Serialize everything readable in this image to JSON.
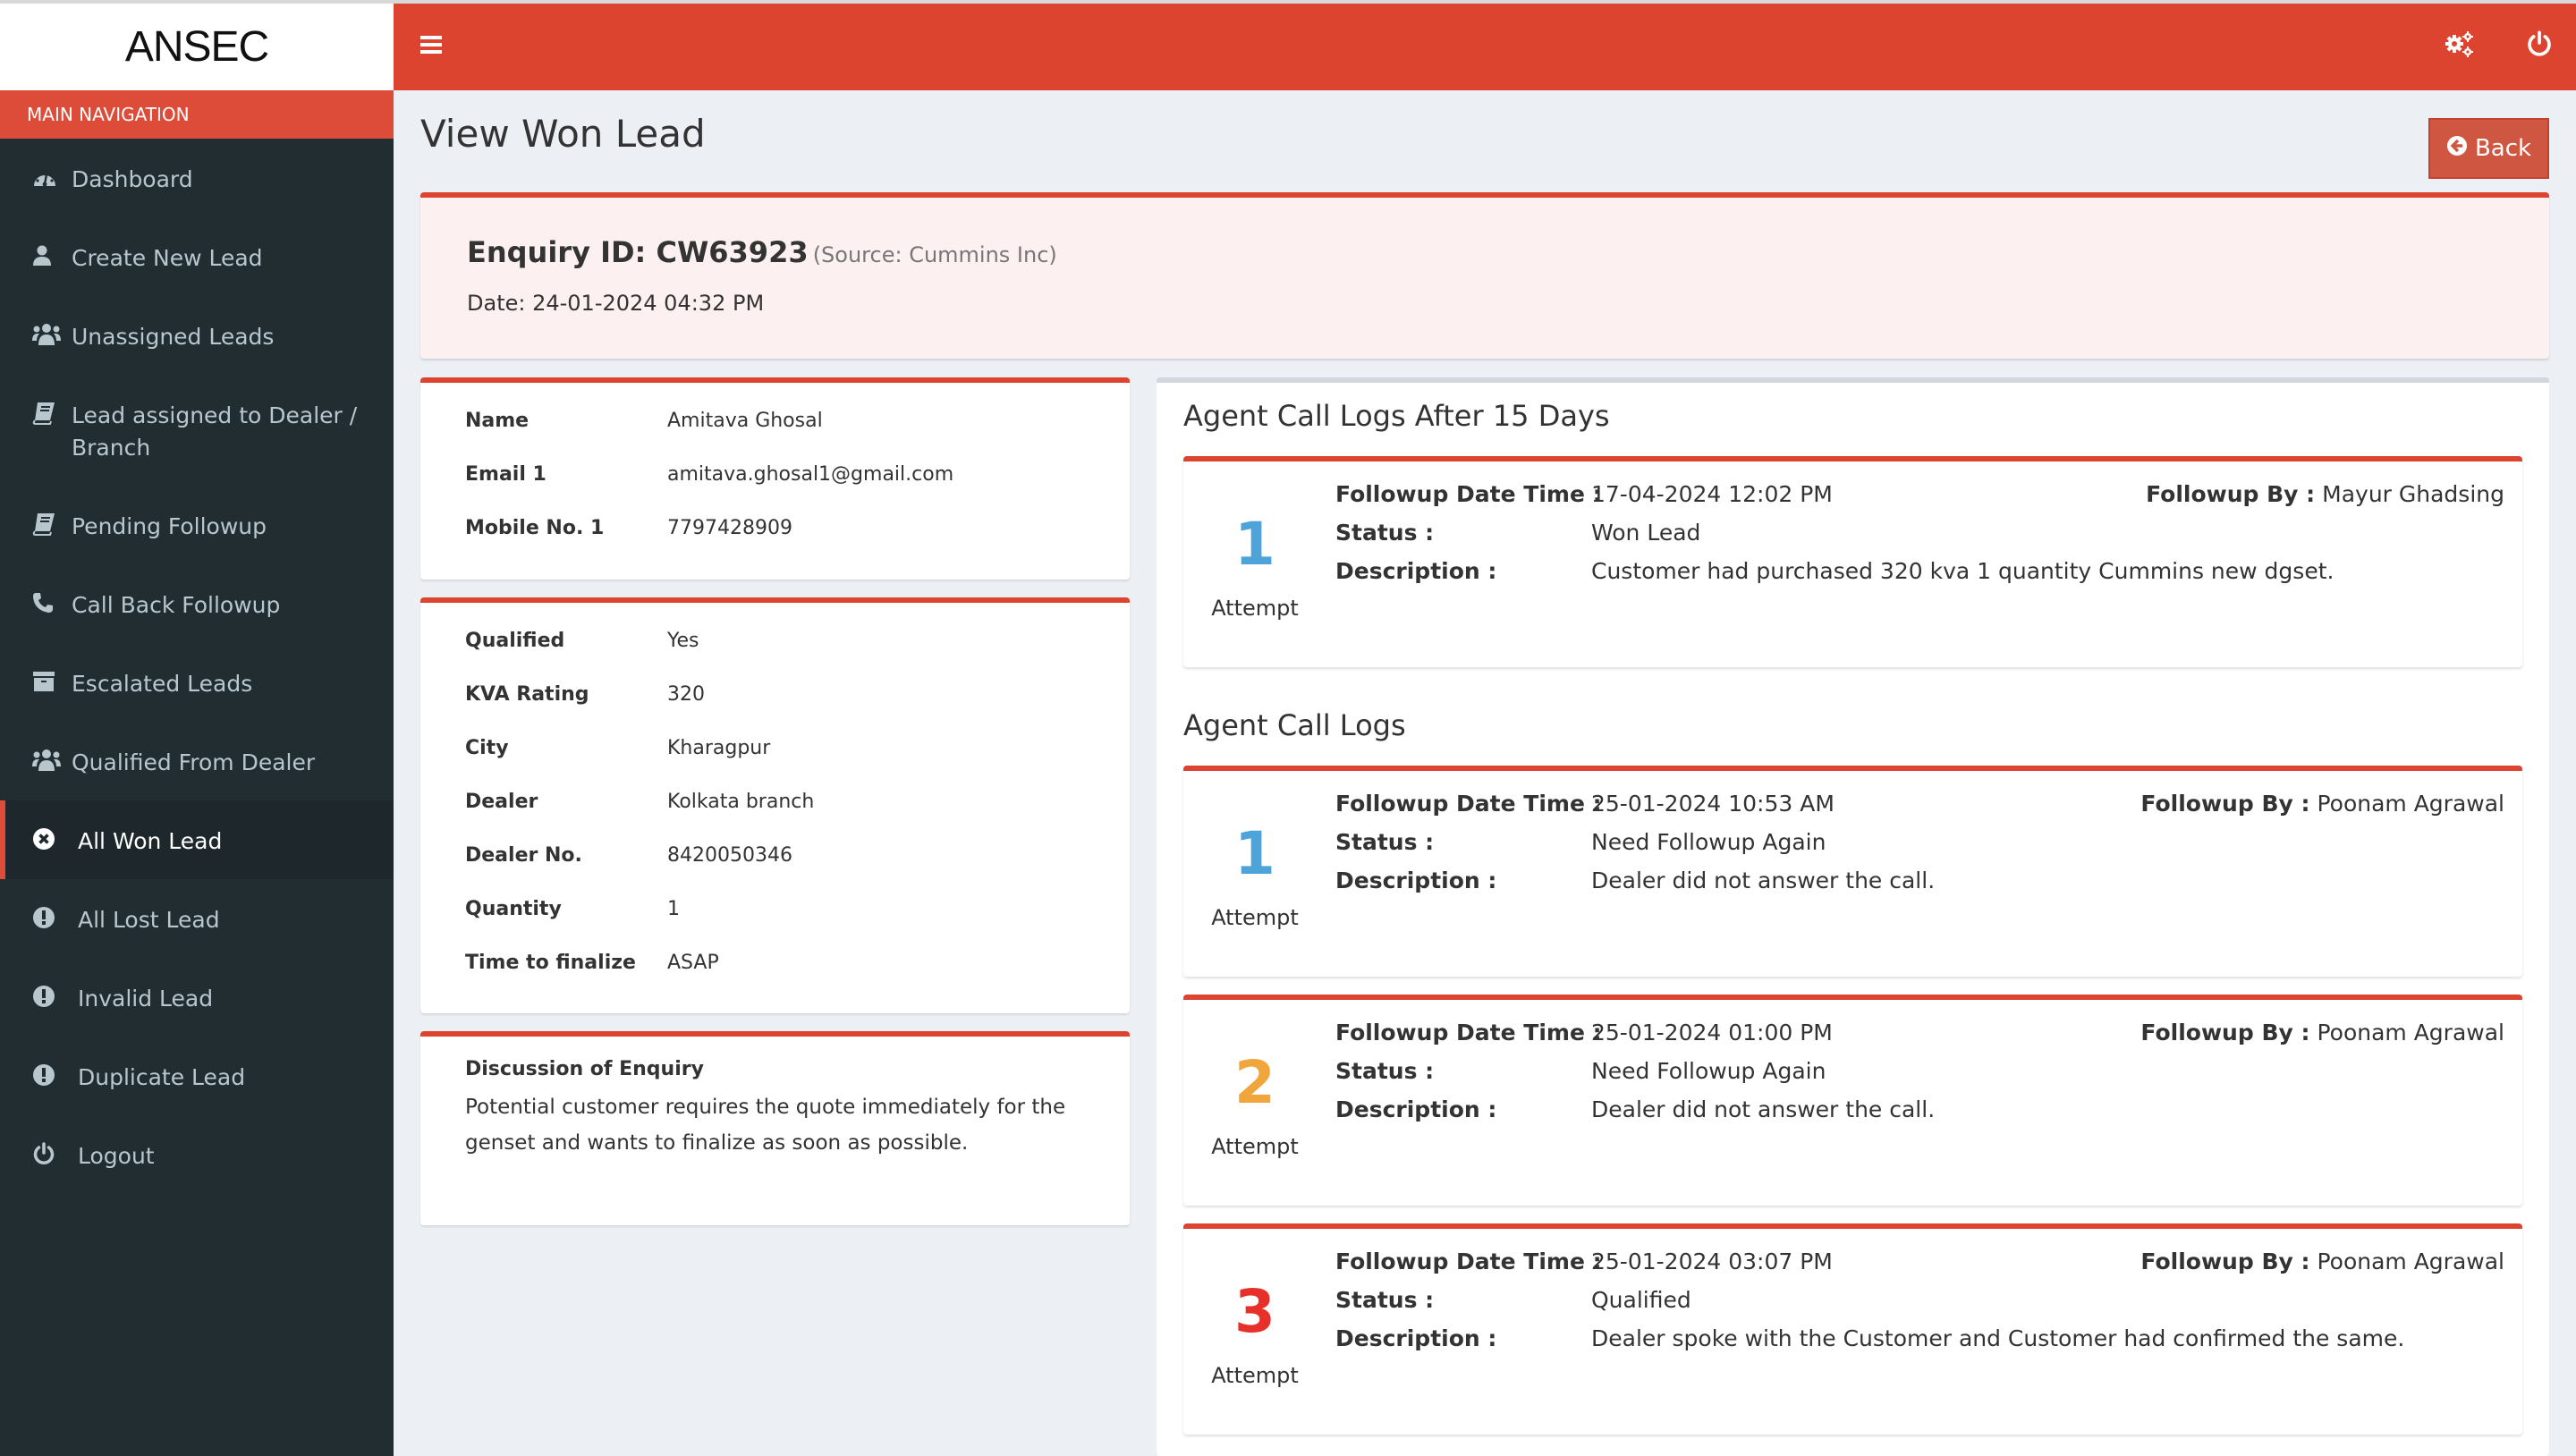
{
  "app": {
    "logo": "ANSEC"
  },
  "sidebar": {
    "header": "MAIN NAVIGATION",
    "items": [
      {
        "label": "Dashboard",
        "icon": "dashboard-icon"
      },
      {
        "label": "Create New Lead",
        "icon": "user-icon"
      },
      {
        "label": "Unassigned Leads",
        "icon": "users-icon"
      },
      {
        "label": "Lead assigned to Dealer / Branch",
        "icon": "book-icon"
      },
      {
        "label": "Pending Followup",
        "icon": "book-icon"
      },
      {
        "label": "Call Back Followup",
        "icon": "phone-icon"
      },
      {
        "label": "Escalated Leads",
        "icon": "archive-icon"
      },
      {
        "label": "Qualified From Dealer",
        "icon": "users-icon"
      },
      {
        "label": "All Won Lead",
        "icon": "times-circle-icon",
        "active": true
      },
      {
        "label": "All Lost Lead",
        "icon": "exclamation-circle-icon"
      },
      {
        "label": "Invalid Lead",
        "icon": "exclamation-circle-icon"
      },
      {
        "label": "Duplicate Lead",
        "icon": "exclamation-circle-icon"
      },
      {
        "label": "Logout",
        "icon": "power-icon"
      }
    ]
  },
  "header": {
    "icons": [
      "menu-icon",
      "settings-gears-icon",
      "power-icon"
    ]
  },
  "page": {
    "title": "View Won Lead",
    "back_label": "Back"
  },
  "enquiry": {
    "id_label": "Enquiry ID: CW63923",
    "source": "(Source: Cummins Inc)",
    "date": "Date: 24-01-2024 04:32 PM"
  },
  "contact": [
    {
      "key": "Name",
      "value": "Amitava Ghosal"
    },
    {
      "key": "Email 1",
      "value": "amitava.ghosal1@gmail.com"
    },
    {
      "key": "Mobile No. 1",
      "value": "7797428909"
    }
  ],
  "details": [
    {
      "key": "Qualified",
      "value": "Yes"
    },
    {
      "key": "KVA Rating",
      "value": "320"
    },
    {
      "key": "City",
      "value": "Kharagpur"
    },
    {
      "key": "Dealer",
      "value": "Kolkata branch"
    },
    {
      "key": "Dealer No.",
      "value": "8420050346"
    },
    {
      "key": "Quantity",
      "value": "1"
    },
    {
      "key": "Time to finalize",
      "value": "ASAP"
    }
  ],
  "discussion": {
    "title": "Discussion of Enquiry",
    "text": "Potential customer requires the quote immediately for the genset and wants to finalize as soon as possible."
  },
  "labels": {
    "followup_dt": "Followup Date Time :",
    "status": "Status :",
    "description": "Description :",
    "followup_by": "Followup By :",
    "attempt": "Attempt"
  },
  "after15": {
    "title": "Agent Call Logs After 15 Days",
    "logs": [
      {
        "attempt": "1",
        "color": "#4ea3d8",
        "datetime": "17-04-2024 12:02 PM",
        "status": "Won Lead",
        "description": "Customer had purchased 320 kva 1 quantity Cummins new dgset.",
        "by": "Mayur Ghadsing"
      }
    ]
  },
  "calllogs": {
    "title": "Agent Call Logs",
    "logs": [
      {
        "attempt": "1",
        "color": "#4ea3d8",
        "datetime": "25-01-2024 10:53 AM",
        "status": "Need Followup Again",
        "description": "Dealer did not answer the call.",
        "by": "Poonam Agrawal"
      },
      {
        "attempt": "2",
        "color": "#f0a63a",
        "datetime": "25-01-2024 01:00 PM",
        "status": "Need Followup Again",
        "description": "Dealer did not answer the call.",
        "by": "Poonam Agrawal"
      },
      {
        "attempt": "3",
        "color": "#e8302a",
        "datetime": "25-01-2024 03:07 PM",
        "status": "Qualified",
        "description": "Dealer spoke with the Customer and Customer had confirmed the same.",
        "by": "Poonam Agrawal"
      }
    ]
  },
  "colors": {
    "brand": "#dd4430",
    "sidebar": "#222d32",
    "sidebar_text": "#b8c7ce"
  }
}
